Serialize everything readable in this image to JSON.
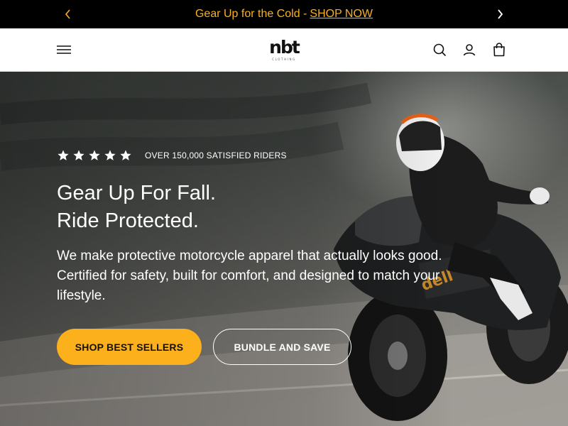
{
  "announcement": {
    "text": "Gear Up for the Cold -",
    "link": "SHOP NOW"
  },
  "header": {
    "logo_text": "nbt",
    "logo_subtext": "CLOTHING",
    "icons": [
      "hamburger-menu-icon",
      "search-icon",
      "account-icon",
      "cart-icon"
    ]
  },
  "hero": {
    "rating": {
      "stars": 5,
      "text": "OVER 150,000 SATISFIED RIDERS"
    },
    "headline_line1": "Gear Up For Fall.",
    "headline_line2": "Ride Protected.",
    "subtext": "We make protective motorcycle apparel that actually looks good. Certified for safety, built for comfort, and designed to match your lifestyle.",
    "primary_button": "SHOP BEST SELLERS",
    "secondary_button": "BUNDLE AND SAVE"
  },
  "colors": {
    "accent": "#fbb01c",
    "announcement_bg": "#000000",
    "header_bg": "#ffffff"
  }
}
